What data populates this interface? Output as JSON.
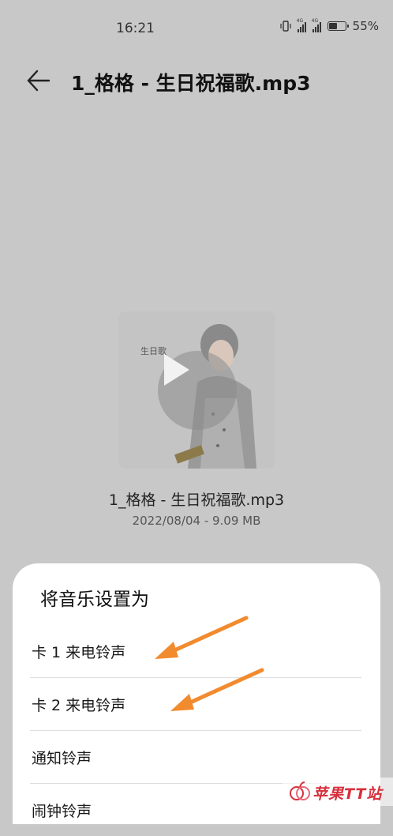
{
  "status_bar": {
    "time": "16:21",
    "signal_1_label": "4G",
    "signal_2_label": "4G",
    "battery_text": "55%",
    "battery_level": 0.55
  },
  "header": {
    "back_icon": "arrow-left-icon",
    "title": "1_格格 - 生日祝福歌.mp3"
  },
  "media": {
    "file_name": "1_格格 - 生日祝福歌.mp3",
    "meta": "2022/08/04 - 9.09 MB",
    "cover_text": "生日歌",
    "play_icon": "play-icon"
  },
  "sheet": {
    "title": "将音乐设置为",
    "options": [
      {
        "label": "卡 1 来电铃声"
      },
      {
        "label": "卡 2 来电铃声"
      },
      {
        "label": "通知铃声"
      },
      {
        "label": "闹钟铃声"
      }
    ]
  },
  "colors": {
    "background_dim": "#c8c8c8",
    "sheet": "#ffffff",
    "annotation_arrow": "#f28a2e",
    "watermark": "#d6303c"
  },
  "watermark": {
    "text": "苹果TT站"
  }
}
